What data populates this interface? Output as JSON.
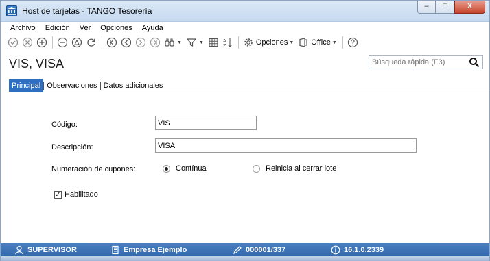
{
  "window": {
    "title": "Host de tarjetas - TANGO Tesorería",
    "controls": {
      "minimize": "–",
      "maximize": "□",
      "close": "X"
    }
  },
  "menu": [
    {
      "label": "Archivo"
    },
    {
      "label": "Edición"
    },
    {
      "label": "Ver"
    },
    {
      "label": "Opciones"
    },
    {
      "label": "Ayuda"
    }
  ],
  "toolbar": {
    "options_label": "Opciones",
    "office_label": "Office"
  },
  "header": {
    "record_title": "VIS, VISA",
    "search_placeholder": "Búsqueda rápida (F3)"
  },
  "tabs": [
    {
      "label": "Principal",
      "active": true
    },
    {
      "label": "Observaciones",
      "active": false
    },
    {
      "label": "Datos adicionales",
      "active": false
    }
  ],
  "form": {
    "codigo_label": "Código:",
    "codigo_value": "VIS",
    "descripcion_label": "Descripción:",
    "descripcion_value": "VISA",
    "numeracion_label": "Numeración de cupones:",
    "radio_continua": "Contínua",
    "radio_reinicia": "Reinicia al cerrar lote",
    "selected_numeracion": "Contínua",
    "habilitado_label": "Habilitado",
    "habilitado_checked": true
  },
  "status": {
    "user": "SUPERVISOR",
    "company": "Empresa Ejemplo",
    "id": "000001/337",
    "version": "16.1.0.2339"
  },
  "colors": {
    "status_bar": "#3a72b7",
    "active_tab": "#2f6fc2"
  }
}
